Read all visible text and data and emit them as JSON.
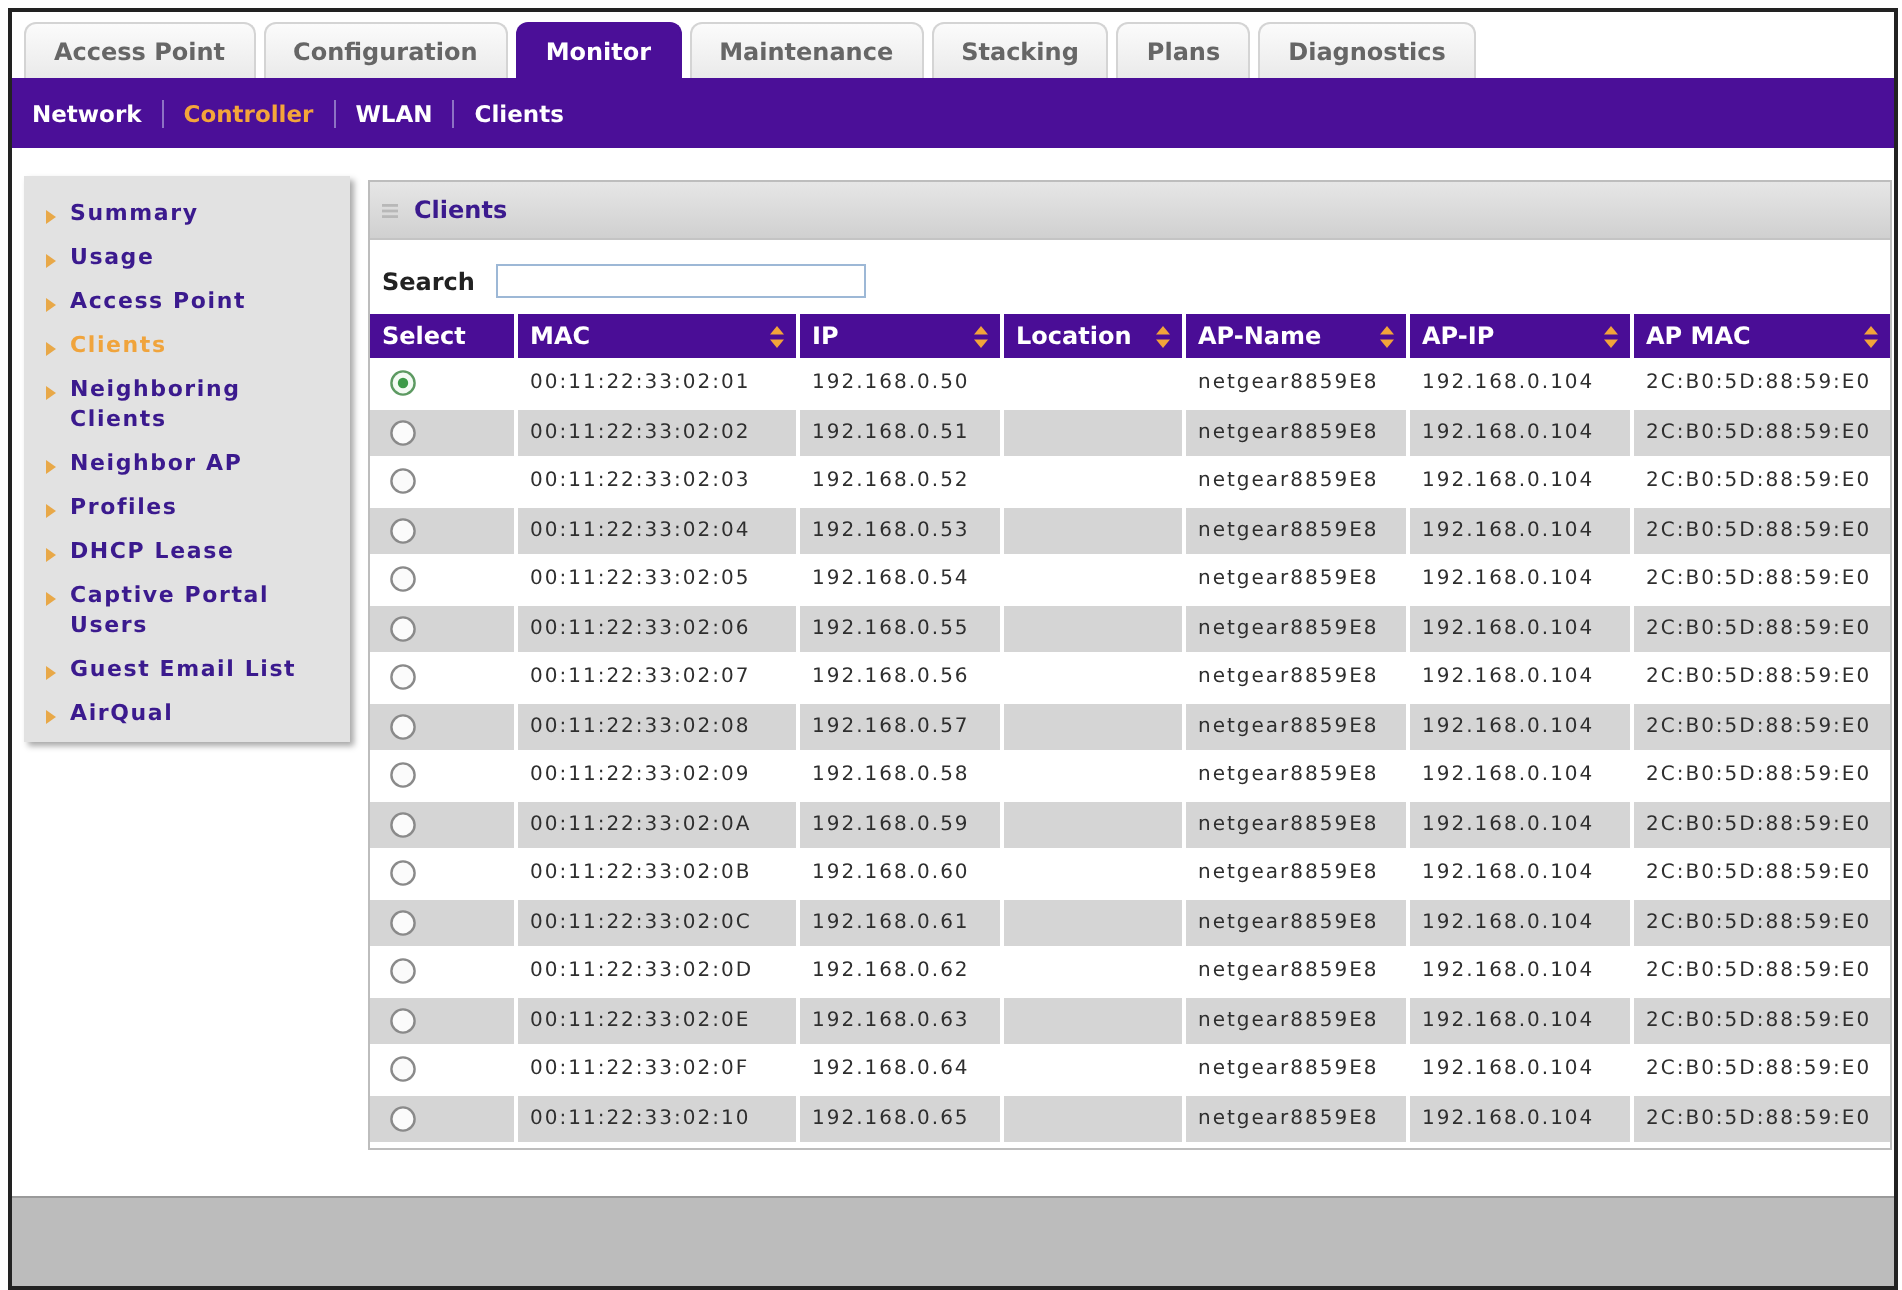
{
  "tabs": [
    {
      "label": "Access Point",
      "selected": false
    },
    {
      "label": "Configuration",
      "selected": false
    },
    {
      "label": "Monitor",
      "selected": true
    },
    {
      "label": "Maintenance",
      "selected": false
    },
    {
      "label": "Stacking",
      "selected": false
    },
    {
      "label": "Plans",
      "selected": false
    },
    {
      "label": "Diagnostics",
      "selected": false
    }
  ],
  "subnav": [
    {
      "label": "Network",
      "selected": false
    },
    {
      "label": "Controller",
      "selected": true
    },
    {
      "label": "WLAN",
      "selected": false
    },
    {
      "label": "Clients",
      "selected": false
    }
  ],
  "sidebar": {
    "items": [
      {
        "label": "Summary",
        "selected": false
      },
      {
        "label": "Usage",
        "selected": false
      },
      {
        "label": "Access Point",
        "selected": false
      },
      {
        "label": "Clients",
        "selected": true
      },
      {
        "label": "Neighboring Clients",
        "selected": false
      },
      {
        "label": "Neighbor AP",
        "selected": false
      },
      {
        "label": "Profiles",
        "selected": false
      },
      {
        "label": "DHCP Lease",
        "selected": false
      },
      {
        "label": "Captive Portal Users",
        "selected": false
      },
      {
        "label": "Guest Email List",
        "selected": false
      },
      {
        "label": "AirQual",
        "selected": false
      }
    ]
  },
  "panel": {
    "title": "Clients",
    "search": {
      "label": "Search"
    },
    "table": {
      "columns": [
        {
          "label": "Select",
          "sortable": false
        },
        {
          "label": "MAC",
          "sortable": true
        },
        {
          "label": "IP",
          "sortable": true
        },
        {
          "label": "Location",
          "sortable": true
        },
        {
          "label": "AP-Name",
          "sortable": true
        },
        {
          "label": "AP-IP",
          "sortable": true
        },
        {
          "label": "AP MAC",
          "sortable": true
        }
      ],
      "rows": [
        {
          "selected": true,
          "mac": "00:11:22:33:02:01",
          "ip": "192.168.0.50",
          "ap_name": "netgear8859E8",
          "ap_ip": "192.168.0.104",
          "ap_mac": "2C:B0:5D:88:59:E0"
        },
        {
          "selected": false,
          "mac": "00:11:22:33:02:02",
          "ip": "192.168.0.51",
          "ap_name": "netgear8859E8",
          "ap_ip": "192.168.0.104",
          "ap_mac": "2C:B0:5D:88:59:E0"
        },
        {
          "selected": false,
          "mac": "00:11:22:33:02:03",
          "ip": "192.168.0.52",
          "ap_name": "netgear8859E8",
          "ap_ip": "192.168.0.104",
          "ap_mac": "2C:B0:5D:88:59:E0"
        },
        {
          "selected": false,
          "mac": "00:11:22:33:02:04",
          "ip": "192.168.0.53",
          "ap_name": "netgear8859E8",
          "ap_ip": "192.168.0.104",
          "ap_mac": "2C:B0:5D:88:59:E0"
        },
        {
          "selected": false,
          "mac": "00:11:22:33:02:05",
          "ip": "192.168.0.54",
          "ap_name": "netgear8859E8",
          "ap_ip": "192.168.0.104",
          "ap_mac": "2C:B0:5D:88:59:E0"
        },
        {
          "selected": false,
          "mac": "00:11:22:33:02:06",
          "ip": "192.168.0.55",
          "ap_name": "netgear8859E8",
          "ap_ip": "192.168.0.104",
          "ap_mac": "2C:B0:5D:88:59:E0"
        },
        {
          "selected": false,
          "mac": "00:11:22:33:02:07",
          "ip": "192.168.0.56",
          "ap_name": "netgear8859E8",
          "ap_ip": "192.168.0.104",
          "ap_mac": "2C:B0:5D:88:59:E0"
        },
        {
          "selected": false,
          "mac": "00:11:22:33:02:08",
          "ip": "192.168.0.57",
          "ap_name": "netgear8859E8",
          "ap_ip": "192.168.0.104",
          "ap_mac": "2C:B0:5D:88:59:E0"
        },
        {
          "selected": false,
          "mac": "00:11:22:33:02:09",
          "ip": "192.168.0.58",
          "ap_name": "netgear8859E8",
          "ap_ip": "192.168.0.104",
          "ap_mac": "2C:B0:5D:88:59:E0"
        },
        {
          "selected": false,
          "mac": "00:11:22:33:02:0A",
          "ip": "192.168.0.59",
          "ap_name": "netgear8859E8",
          "ap_ip": "192.168.0.104",
          "ap_mac": "2C:B0:5D:88:59:E0"
        },
        {
          "selected": false,
          "mac": "00:11:22:33:02:0B",
          "ip": "192.168.0.60",
          "ap_name": "netgear8859E8",
          "ap_ip": "192.168.0.104",
          "ap_mac": "2C:B0:5D:88:59:E0"
        },
        {
          "selected": false,
          "mac": "00:11:22:33:02:0C",
          "ip": "192.168.0.61",
          "ap_name": "netgear8859E8",
          "ap_ip": "192.168.0.104",
          "ap_mac": "2C:B0:5D:88:59:E0"
        },
        {
          "selected": false,
          "mac": "00:11:22:33:02:0D",
          "ip": "192.168.0.62",
          "ap_name": "netgear8859E8",
          "ap_ip": "192.168.0.104",
          "ap_mac": "2C:B0:5D:88:59:E0"
        },
        {
          "selected": false,
          "mac": "00:11:22:33:02:0E",
          "ip": "192.168.0.63",
          "ap_name": "netgear8859E8",
          "ap_ip": "192.168.0.104",
          "ap_mac": "2C:B0:5D:88:59:E0"
        },
        {
          "selected": false,
          "mac": "00:11:22:33:02:0F",
          "ip": "192.168.0.64",
          "ap_name": "netgear8859E8",
          "ap_ip": "192.168.0.104",
          "ap_mac": "2C:B0:5D:88:59:E0"
        },
        {
          "selected": false,
          "mac": "00:11:22:33:02:10",
          "ip": "192.168.0.65",
          "ap_name": "netgear8859E8",
          "ap_ip": "192.168.0.104",
          "ap_mac": "2C:B0:5D:88:59:E0"
        }
      ]
    }
  }
}
